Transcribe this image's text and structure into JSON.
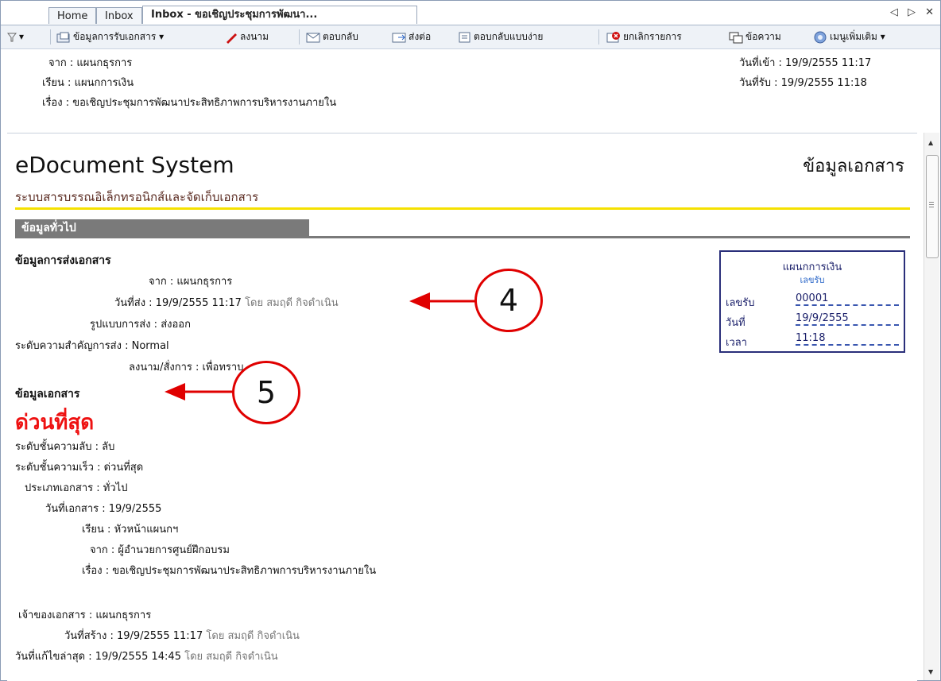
{
  "tabs": [
    "Home",
    "Inbox",
    "Inbox - ขอเชิญประชุมการพัฒนา..."
  ],
  "tabnav": {
    "prev": "◁",
    "next": "▷",
    "close": "✕"
  },
  "toolbar": {
    "filter": "▾",
    "receive_info": "ข้อมูลการรับเอกสาร ▾",
    "sign": "ลงนาม",
    "reply": "ตอบกลับ",
    "forward": "ส่งต่อ",
    "quick_reply": "ตอบกลับแบบง่าย",
    "cancel_item": "ยกเลิกรายการ",
    "message": "ข้อความ",
    "more_menu": "เมนูเพิ่มเติม ▾"
  },
  "header": {
    "from": "จาก : แผนกธุรการ",
    "to": "เรียน : แผนกการเงิน",
    "subject": "เรื่อง : ขอเชิญประชุมการพัฒนาประสิทธิภาพการบริหารงานภายใน",
    "in_date": "วันที่เข้า : 19/9/2555 11:17",
    "recv_date": "วันที่รับ : 19/9/2555 11:18"
  },
  "doc": {
    "title": "eDocument System",
    "title_right": "ข้อมูลเอกสาร",
    "subtitle": "ระบบสารบรรณอิเล็กทรอนิกส์และจัดเก็บเอกสาร",
    "section": "ข้อมูลทั่วไป",
    "send_header": "ข้อมูลการส่งเอกสาร",
    "send_from": "จาก : แผนกธุรการ",
    "send_date": "วันที่ส่ง : 19/9/2555 11:17",
    "send_by": "โดย สมฤดี กิจดำเนิน",
    "send_type": "รูปแบบการส่ง : ส่งออก",
    "send_priority": "ระดับความสำคัญการส่ง : Normal",
    "sign_cmd": "ลงนาม/สั่งการ : เพื่อทราบ",
    "doc_header": "ข้อมูลเอกสาร",
    "urgency": "ด่วนที่สุด",
    "secret": "ระดับชั้นความลับ : ลับ",
    "speed": "ระดับชั้นความเร็ว : ด่วนที่สุด",
    "doc_type": "ประเภทเอกสาร : ทั่วไป",
    "doc_date": "วันที่เอกสาร : 19/9/2555",
    "doc_to": "เรียน : หัวหน้าแผนกฯ",
    "doc_from": "จาก : ผู้อำนวยการศูนย์ฝึกอบรม",
    "doc_subject": "เรื่อง : ขอเชิญประชุมการพัฒนาประสิทธิภาพการบริหารงานภายใน",
    "owner": "เจ้าของเอกสาร : แผนกธุรการ",
    "created": "วันที่สร้าง : 19/9/2555 11:17",
    "created_by": "โดย สมฤดี กิจดำเนิน",
    "modified": "วันที่แก้ไขล่าสุด : 19/9/2555 14:45",
    "modified_by": "โดย สมฤดี กิจดำเนิน"
  },
  "stamp": {
    "dept": "แผนกการเงิน",
    "label": "เลขรับ",
    "no_label": "เลขรับ",
    "no_value": "00001",
    "date_label": "วันที่",
    "date_value": "19/9/2555",
    "time_label": "เวลา",
    "time_value": "11:18"
  },
  "callouts": {
    "c4": "4",
    "c5": "5"
  },
  "colors": {
    "accent_red": "#e00000",
    "urgent": "#ee1111",
    "yellow_rule": "#f5e100",
    "stamp_border": "#2a2f7a"
  }
}
